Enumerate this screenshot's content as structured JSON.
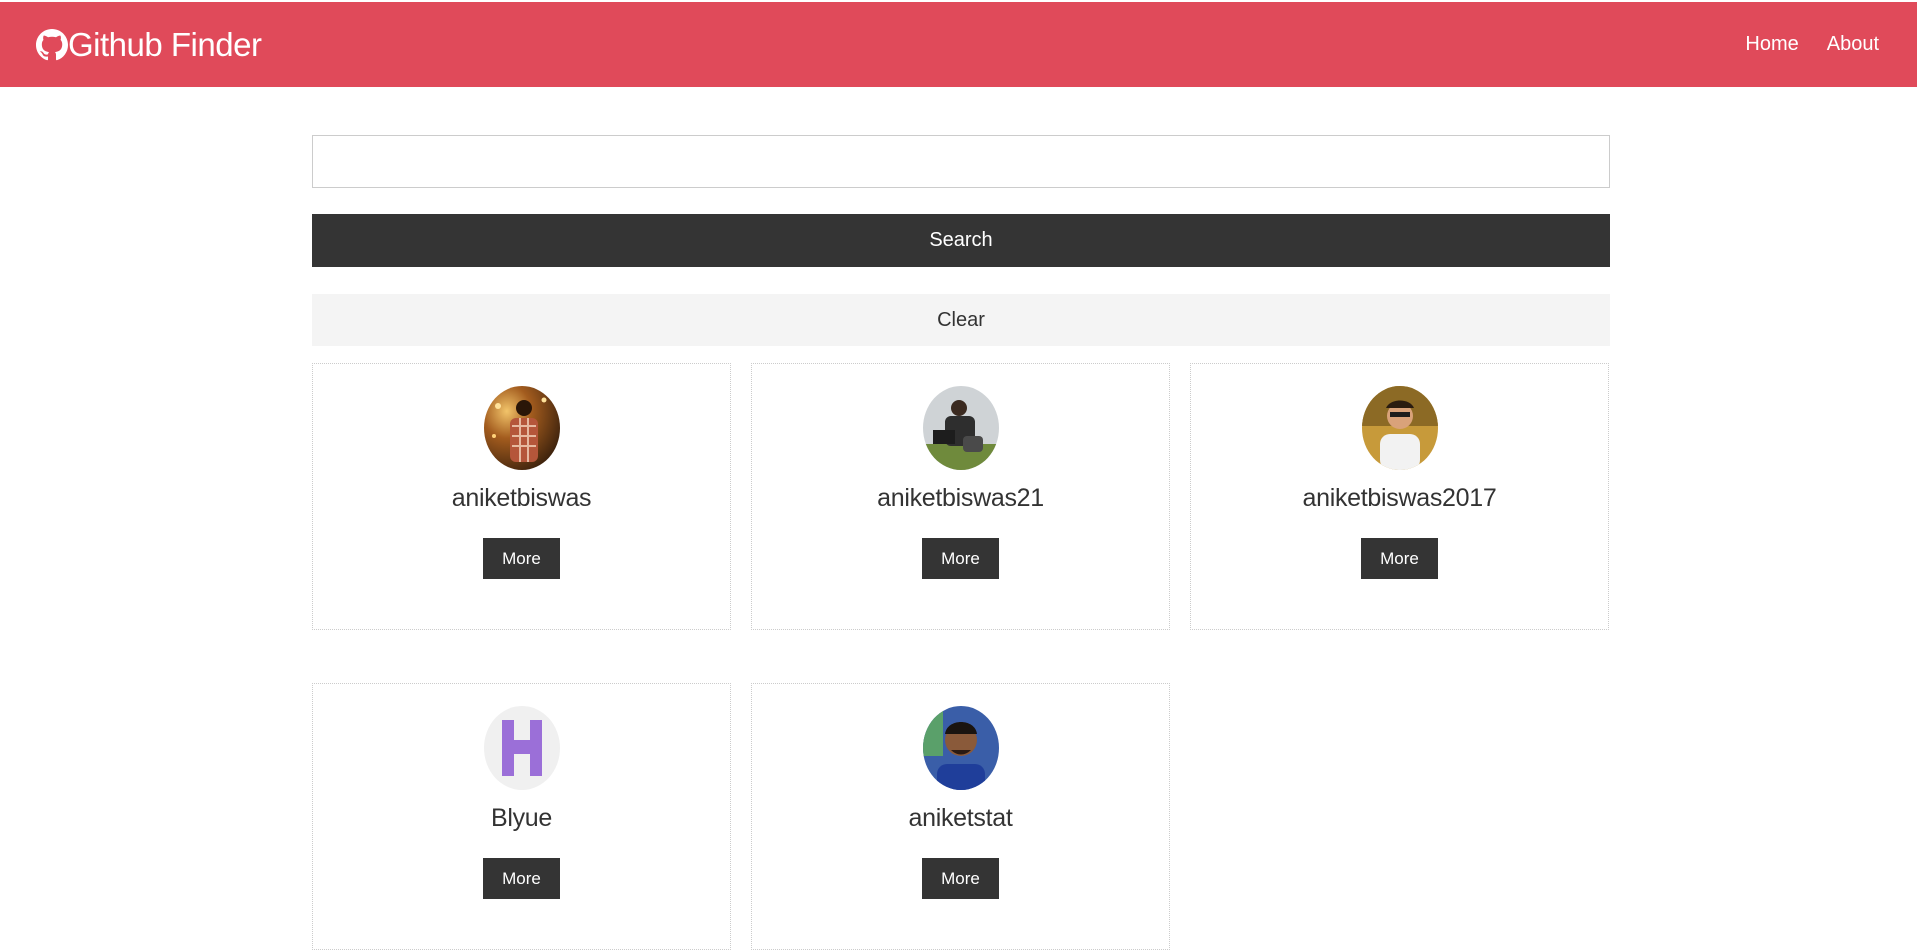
{
  "navbar": {
    "brand": "Github Finder",
    "brand_icon": "github-icon",
    "links": [
      {
        "label": "Home"
      },
      {
        "label": "About"
      }
    ],
    "background_color": "#e04a5a"
  },
  "search": {
    "value": "",
    "placeholder": "",
    "search_label": "Search",
    "clear_label": "Clear"
  },
  "users": [
    {
      "login": "aniketbiswas",
      "more_label": "More",
      "avatar_icon": "user-avatar-photo"
    },
    {
      "login": "aniketbiswas21",
      "more_label": "More",
      "avatar_icon": "user-avatar-photo"
    },
    {
      "login": "aniketbiswas2017",
      "more_label": "More",
      "avatar_icon": "user-avatar-photo"
    },
    {
      "login": "Blyue",
      "more_label": "More",
      "avatar_icon": "identicon-avatar"
    },
    {
      "login": "aniketstat",
      "more_label": "More",
      "avatar_icon": "user-avatar-photo"
    }
  ],
  "colors": {
    "primary_dark": "#343434",
    "light": "#f4f4f4",
    "identicon": "#9b6fd8"
  }
}
